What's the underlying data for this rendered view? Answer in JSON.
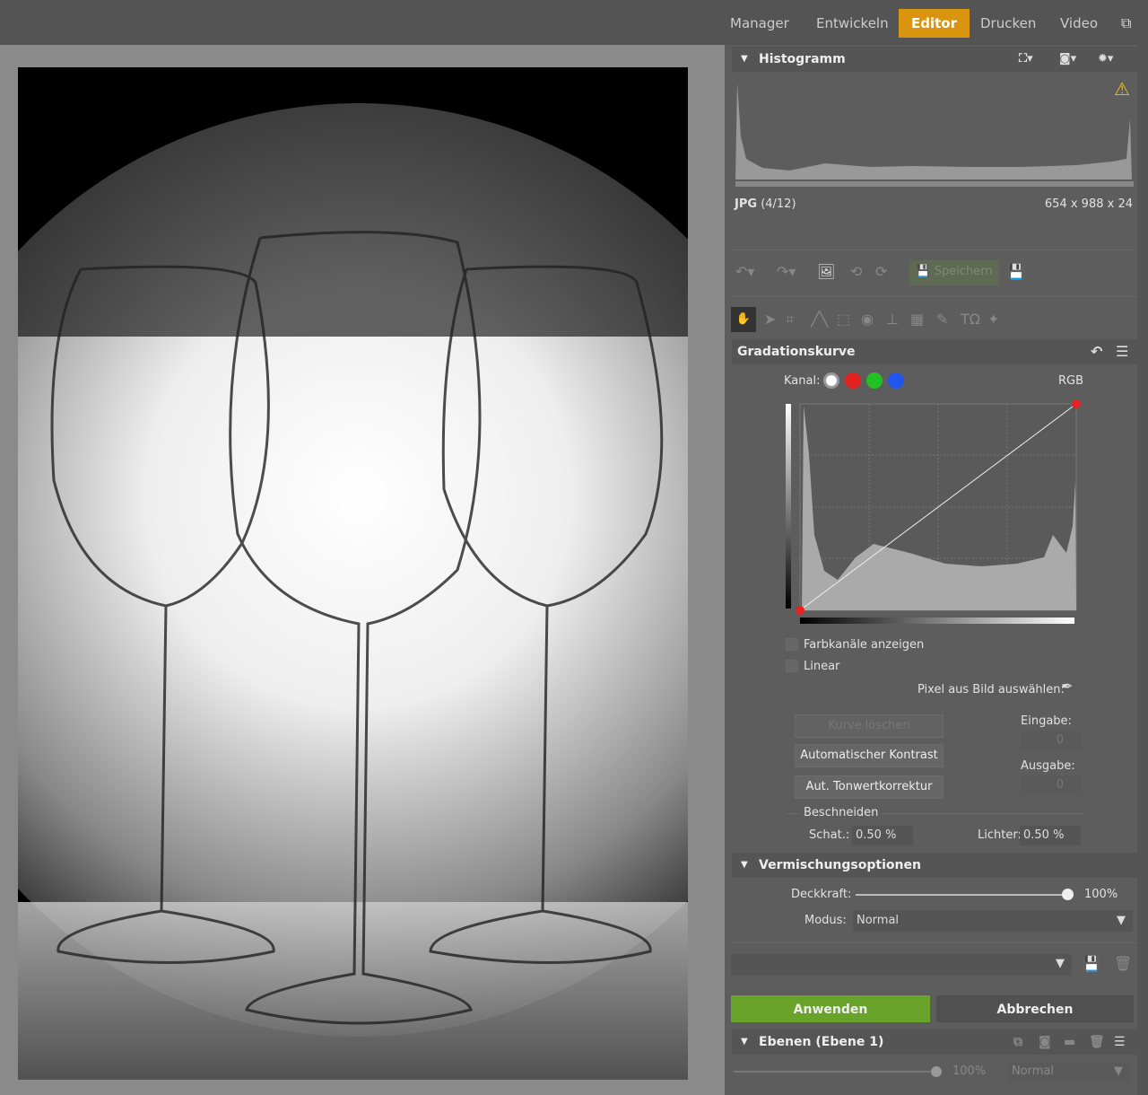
{
  "nav": {
    "items": [
      "Manager",
      "Entwickeln",
      "Editor",
      "Drucken",
      "Video"
    ],
    "active": "Editor",
    "accent": "#d9950f"
  },
  "histogram": {
    "title": "Histogramm",
    "format": "JPG",
    "index": "(4/12)",
    "dimensions": "654 x 988 x 24",
    "warning_icon": "warning-icon"
  },
  "toolbar": {
    "save_label": "Speichern"
  },
  "curves": {
    "title": "Gradationskurve",
    "channel_label": "Kanal:",
    "channel_value": "RGB",
    "channels": [
      "#ffffff",
      "#e52222",
      "#22c022",
      "#2255ee"
    ],
    "show_channels": "Farbkanäle anzeigen",
    "linear": "Linear",
    "pick_pixel": "Pixel aus Bild auswählen:",
    "clear_curve": "Kurve löschen",
    "auto_contrast": "Automatischer Kontrast",
    "auto_levels": "Aut. Tonwertkorrektur",
    "input_label": "Eingabe:",
    "input_value": "0",
    "output_label": "Ausgabe:",
    "output_value": "0",
    "clip_label": "Beschneiden",
    "shadows_label": "Schat.:",
    "shadows_value": "0.50 %",
    "highlights_label": "Lichter:",
    "highlights_value": "0.50 %"
  },
  "blend": {
    "title": "Vermischungsoptionen",
    "opacity_label": "Deckkraft:",
    "opacity_value": "100%",
    "opacity": 1.0,
    "mode_label": "Modus:",
    "mode_value": "Normal"
  },
  "actions": {
    "apply": "Anwenden",
    "cancel": "Abbrechen",
    "apply_color": "#6aa32a"
  },
  "layers": {
    "title": "Ebenen (Ebene 1)",
    "opacity_value": "100%",
    "mode_value": "Normal"
  }
}
